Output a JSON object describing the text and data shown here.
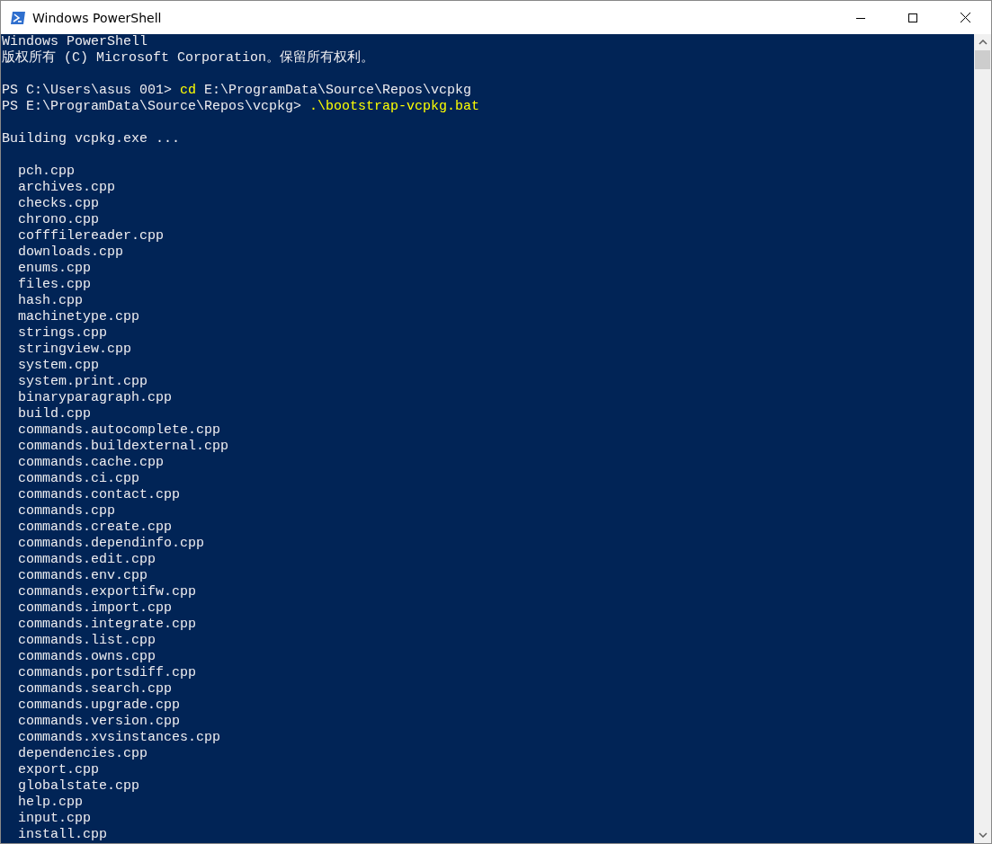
{
  "window": {
    "title": "Windows PowerShell"
  },
  "console": {
    "blocks": [
      {
        "lines": [
          {
            "segments": [
              {
                "kind": "output",
                "text": "Windows PowerShell"
              }
            ]
          },
          {
            "segments": [
              {
                "kind": "output",
                "text": "版权所有 (C) Microsoft Corporation。保留所有权利。"
              }
            ]
          }
        ]
      },
      {
        "lines": [
          {
            "segments": [
              {
                "kind": "output",
                "text": "PS C:\\Users\\asus 001> "
              },
              {
                "kind": "command",
                "text": "cd"
              },
              {
                "kind": "output",
                "text": " E:\\ProgramData\\Source\\Repos\\vcpkg"
              }
            ]
          },
          {
            "segments": [
              {
                "kind": "output",
                "text": "PS E:\\ProgramData\\Source\\Repos\\vcpkg> "
              },
              {
                "kind": "command",
                "text": ".\\bootstrap-vcpkg.bat"
              }
            ]
          }
        ]
      },
      {
        "lines": [
          {
            "segments": [
              {
                "kind": "output",
                "text": "Building vcpkg.exe ..."
              }
            ]
          }
        ]
      },
      {
        "lines": [
          {
            "segments": [
              {
                "kind": "output",
                "text": "  pch.cpp"
              }
            ]
          },
          {
            "segments": [
              {
                "kind": "output",
                "text": "  archives.cpp"
              }
            ]
          },
          {
            "segments": [
              {
                "kind": "output",
                "text": "  checks.cpp"
              }
            ]
          },
          {
            "segments": [
              {
                "kind": "output",
                "text": "  chrono.cpp"
              }
            ]
          },
          {
            "segments": [
              {
                "kind": "output",
                "text": "  cofffilereader.cpp"
              }
            ]
          },
          {
            "segments": [
              {
                "kind": "output",
                "text": "  downloads.cpp"
              }
            ]
          },
          {
            "segments": [
              {
                "kind": "output",
                "text": "  enums.cpp"
              }
            ]
          },
          {
            "segments": [
              {
                "kind": "output",
                "text": "  files.cpp"
              }
            ]
          },
          {
            "segments": [
              {
                "kind": "output",
                "text": "  hash.cpp"
              }
            ]
          },
          {
            "segments": [
              {
                "kind": "output",
                "text": "  machinetype.cpp"
              }
            ]
          },
          {
            "segments": [
              {
                "kind": "output",
                "text": "  strings.cpp"
              }
            ]
          },
          {
            "segments": [
              {
                "kind": "output",
                "text": "  stringview.cpp"
              }
            ]
          },
          {
            "segments": [
              {
                "kind": "output",
                "text": "  system.cpp"
              }
            ]
          },
          {
            "segments": [
              {
                "kind": "output",
                "text": "  system.print.cpp"
              }
            ]
          },
          {
            "segments": [
              {
                "kind": "output",
                "text": "  binaryparagraph.cpp"
              }
            ]
          },
          {
            "segments": [
              {
                "kind": "output",
                "text": "  build.cpp"
              }
            ]
          },
          {
            "segments": [
              {
                "kind": "output",
                "text": "  commands.autocomplete.cpp"
              }
            ]
          },
          {
            "segments": [
              {
                "kind": "output",
                "text": "  commands.buildexternal.cpp"
              }
            ]
          },
          {
            "segments": [
              {
                "kind": "output",
                "text": "  commands.cache.cpp"
              }
            ]
          },
          {
            "segments": [
              {
                "kind": "output",
                "text": "  commands.ci.cpp"
              }
            ]
          },
          {
            "segments": [
              {
                "kind": "output",
                "text": "  commands.contact.cpp"
              }
            ]
          },
          {
            "segments": [
              {
                "kind": "output",
                "text": "  commands.cpp"
              }
            ]
          },
          {
            "segments": [
              {
                "kind": "output",
                "text": "  commands.create.cpp"
              }
            ]
          },
          {
            "segments": [
              {
                "kind": "output",
                "text": "  commands.dependinfo.cpp"
              }
            ]
          },
          {
            "segments": [
              {
                "kind": "output",
                "text": "  commands.edit.cpp"
              }
            ]
          },
          {
            "segments": [
              {
                "kind": "output",
                "text": "  commands.env.cpp"
              }
            ]
          },
          {
            "segments": [
              {
                "kind": "output",
                "text": "  commands.exportifw.cpp"
              }
            ]
          },
          {
            "segments": [
              {
                "kind": "output",
                "text": "  commands.import.cpp"
              }
            ]
          },
          {
            "segments": [
              {
                "kind": "output",
                "text": "  commands.integrate.cpp"
              }
            ]
          },
          {
            "segments": [
              {
                "kind": "output",
                "text": "  commands.list.cpp"
              }
            ]
          },
          {
            "segments": [
              {
                "kind": "output",
                "text": "  commands.owns.cpp"
              }
            ]
          },
          {
            "segments": [
              {
                "kind": "output",
                "text": "  commands.portsdiff.cpp"
              }
            ]
          },
          {
            "segments": [
              {
                "kind": "output",
                "text": "  commands.search.cpp"
              }
            ]
          },
          {
            "segments": [
              {
                "kind": "output",
                "text": "  commands.upgrade.cpp"
              }
            ]
          },
          {
            "segments": [
              {
                "kind": "output",
                "text": "  commands.version.cpp"
              }
            ]
          },
          {
            "segments": [
              {
                "kind": "output",
                "text": "  commands.xvsinstances.cpp"
              }
            ]
          },
          {
            "segments": [
              {
                "kind": "output",
                "text": "  dependencies.cpp"
              }
            ]
          },
          {
            "segments": [
              {
                "kind": "output",
                "text": "  export.cpp"
              }
            ]
          },
          {
            "segments": [
              {
                "kind": "output",
                "text": "  globalstate.cpp"
              }
            ]
          },
          {
            "segments": [
              {
                "kind": "output",
                "text": "  help.cpp"
              }
            ]
          },
          {
            "segments": [
              {
                "kind": "output",
                "text": "  input.cpp"
              }
            ]
          },
          {
            "segments": [
              {
                "kind": "output",
                "text": "  install.cpp"
              }
            ]
          }
        ]
      }
    ]
  }
}
